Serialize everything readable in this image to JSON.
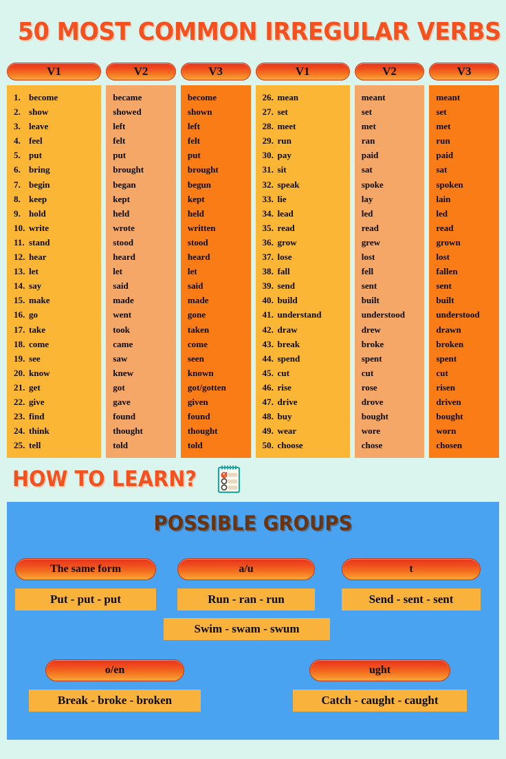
{
  "title": "50 MOST COMMON IRREGULAR VERBS",
  "table": {
    "headers": [
      "V1",
      "V2",
      "V3"
    ],
    "left_rows": [
      {
        "n": "1.",
        "v1": "become",
        "v2": "became",
        "v3": "become"
      },
      {
        "n": "2.",
        "v1": "show",
        "v2": "showed",
        "v3": "shown"
      },
      {
        "n": "3.",
        "v1": "leave",
        "v2": "left",
        "v3": "left"
      },
      {
        "n": "4.",
        "v1": "feel",
        "v2": "felt",
        "v3": "felt"
      },
      {
        "n": "5.",
        "v1": "put",
        "v2": "put",
        "v3": "put"
      },
      {
        "n": "6.",
        "v1": "bring",
        "v2": "brought",
        "v3": "brought"
      },
      {
        "n": "7.",
        "v1": "begin",
        "v2": "began",
        "v3": "begun"
      },
      {
        "n": "8.",
        "v1": "keep",
        "v2": "kept",
        "v3": "kept"
      },
      {
        "n": "9.",
        "v1": "hold",
        "v2": "held",
        "v3": "held"
      },
      {
        "n": "10.",
        "v1": "write",
        "v2": "wrote",
        "v3": "written"
      },
      {
        "n": "11.",
        "v1": "stand",
        "v2": "stood",
        "v3": "stood"
      },
      {
        "n": "12.",
        "v1": "hear",
        "v2": "heard",
        "v3": "heard"
      },
      {
        "n": "13.",
        "v1": "let",
        "v2": "let",
        "v3": "let"
      },
      {
        "n": "14.",
        "v1": "say",
        "v2": "said",
        "v3": "said"
      },
      {
        "n": "15.",
        "v1": "make",
        "v2": "made",
        "v3": "made"
      },
      {
        "n": "16.",
        "v1": "go",
        "v2": "went",
        "v3": "gone"
      },
      {
        "n": "17.",
        "v1": "take",
        "v2": "took",
        "v3": "taken"
      },
      {
        "n": "18.",
        "v1": "come",
        "v2": "came",
        "v3": "come"
      },
      {
        "n": "19.",
        "v1": "see",
        "v2": "saw",
        "v3": "seen"
      },
      {
        "n": "20.",
        "v1": "know",
        "v2": "knew",
        "v3": "known"
      },
      {
        "n": "21.",
        "v1": "get",
        "v2": "got",
        "v3": "got/gotten"
      },
      {
        "n": "22.",
        "v1": "give",
        "v2": "gave",
        "v3": "given"
      },
      {
        "n": "23.",
        "v1": "find",
        "v2": "found",
        "v3": "found"
      },
      {
        "n": "24.",
        "v1": "think",
        "v2": "thought",
        "v3": "thought"
      },
      {
        "n": "25.",
        "v1": "tell",
        "v2": "told",
        "v3": "told"
      }
    ],
    "right_rows": [
      {
        "n": "26.",
        "v1": "mean",
        "v2": "meant",
        "v3": "meant"
      },
      {
        "n": "27.",
        "v1": "set",
        "v2": "set",
        "v3": "set"
      },
      {
        "n": "28.",
        "v1": "meet",
        "v2": "met",
        "v3": "met"
      },
      {
        "n": "29.",
        "v1": "run",
        "v2": "ran",
        "v3": "run"
      },
      {
        "n": "30.",
        "v1": "pay",
        "v2": "paid",
        "v3": "paid"
      },
      {
        "n": "31.",
        "v1": "sit",
        "v2": "sat",
        "v3": "sat"
      },
      {
        "n": "32.",
        "v1": "speak",
        "v2": "spoke",
        "v3": "spoken"
      },
      {
        "n": "33.",
        "v1": "lie",
        "v2": "lay",
        "v3": "lain"
      },
      {
        "n": "34.",
        "v1": "lead",
        "v2": "led",
        "v3": "led"
      },
      {
        "n": "35.",
        "v1": "read",
        "v2": "read",
        "v3": "read"
      },
      {
        "n": "36.",
        "v1": "grow",
        "v2": "grew",
        "v3": "grown"
      },
      {
        "n": "37.",
        "v1": "lose",
        "v2": "lost",
        "v3": "lost"
      },
      {
        "n": "38.",
        "v1": "fall",
        "v2": "fell",
        "v3": "fallen"
      },
      {
        "n": "39.",
        "v1": "send",
        "v2": "sent",
        "v3": "sent"
      },
      {
        "n": "40.",
        "v1": "build",
        "v2": "built",
        "v3": "built"
      },
      {
        "n": "41.",
        "v1": "understand",
        "v2": "understood",
        "v3": "understood"
      },
      {
        "n": "42.",
        "v1": "draw",
        "v2": "drew",
        "v3": "drawn"
      },
      {
        "n": "43.",
        "v1": "break",
        "v2": "broke",
        "v3": "broken"
      },
      {
        "n": "44.",
        "v1": "spend",
        "v2": "spent",
        "v3": "spent"
      },
      {
        "n": "45.",
        "v1": "cut",
        "v2": "cut",
        "v3": "cut"
      },
      {
        "n": "46.",
        "v1": "rise",
        "v2": "rose",
        "v3": "risen"
      },
      {
        "n": "47.",
        "v1": "drive",
        "v2": "drove",
        "v3": "driven"
      },
      {
        "n": "48.",
        "v1": "buy",
        "v2": "bought",
        "v3": "bought"
      },
      {
        "n": "49.",
        "v1": "wear",
        "v2": "wore",
        "v3": "worn"
      },
      {
        "n": "50.",
        "v1": "choose",
        "v2": "chose",
        "v3": "chosen"
      }
    ]
  },
  "howto": {
    "title": "HOW TO LEARN?",
    "icon": "checklist-notepad-icon"
  },
  "panel": {
    "title": "POSSIBLE GROUPS",
    "groups": [
      {
        "label": "The same form",
        "example": "Put - put - put"
      },
      {
        "label": "a/u",
        "example": "Run - ran - run"
      },
      {
        "label": "t",
        "example": "Send - sent - sent"
      },
      {
        "label": "",
        "example": "Swim - swam - swum"
      },
      {
        "label": "o/en",
        "example": "Break - broke - broken"
      },
      {
        "label": "ught",
        "example": "Catch - caught - caught"
      }
    ]
  },
  "colors": {
    "background": "#d9f5ee",
    "title_orange": "#f4511e",
    "v1_column": "#fbb635",
    "v2_column": "#f5a768",
    "v3_column": "#f97c16",
    "panel_blue": "#4aa3f0",
    "panel_title_brown": "#6b3410",
    "yellow_box": "#f9b23b"
  }
}
